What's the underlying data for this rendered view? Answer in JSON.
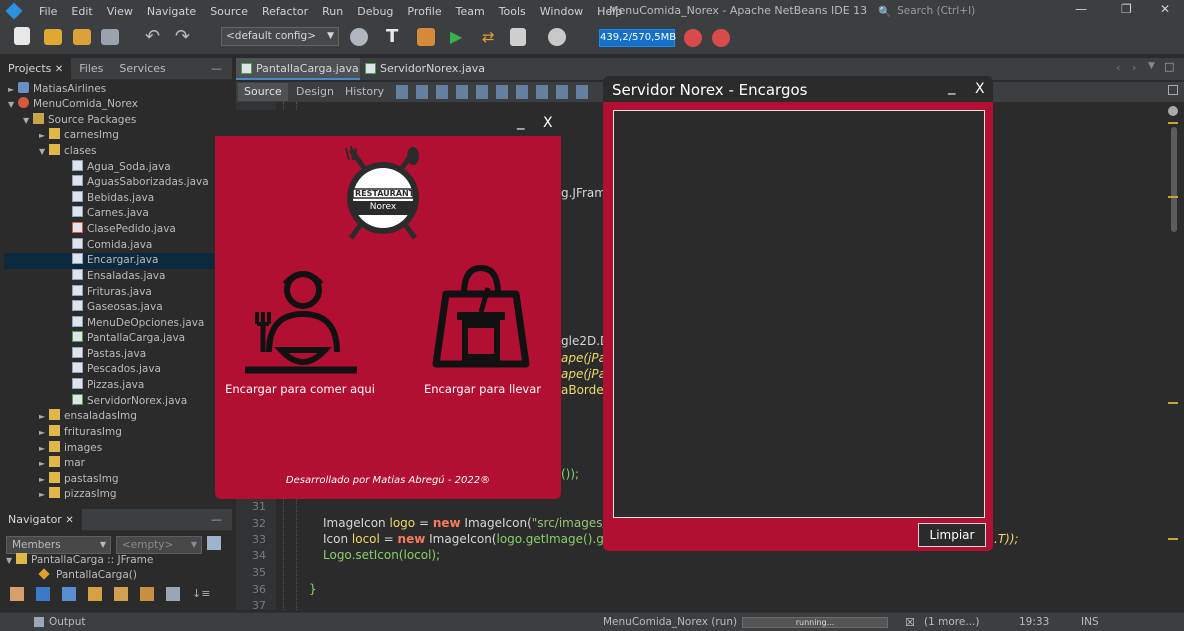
{
  "menu": [
    "File",
    "Edit",
    "View",
    "Navigate",
    "Source",
    "Refactor",
    "Run",
    "Debug",
    "Profile",
    "Team",
    "Tools",
    "Window",
    "Help"
  ],
  "app_title": "MenuComida_Norex - Apache NetBeans IDE 13",
  "search_placeholder": "Search (Ctrl+I)",
  "toolbar": {
    "config": "<default config>",
    "memory": "439,2/570,5MB"
  },
  "left_tabs": [
    "Projects",
    "Files",
    "Services"
  ],
  "tree": [
    {
      "label": "MatiasAirlines",
      "icon": "project"
    },
    {
      "label": "MenuComida_Norex",
      "icon": "project2"
    },
    {
      "label": "Source Packages",
      "icon": "pkg"
    },
    {
      "label": "carnesImg",
      "icon": "folder"
    },
    {
      "label": "clases",
      "icon": "folder"
    },
    {
      "label": "Agua_Soda.java",
      "icon": "java"
    },
    {
      "label": "AguasSaborizadas.java",
      "icon": "java"
    },
    {
      "label": "Bebidas.java",
      "icon": "java"
    },
    {
      "label": "Carnes.java",
      "icon": "java"
    },
    {
      "label": "ClasePedido.java",
      "icon": "java"
    },
    {
      "label": "Comida.java",
      "icon": "java"
    },
    {
      "label": "Encargar.java",
      "icon": "java"
    },
    {
      "label": "Ensaladas.java",
      "icon": "java"
    },
    {
      "label": "Frituras.java",
      "icon": "java"
    },
    {
      "label": "Gaseosas.java",
      "icon": "java"
    },
    {
      "label": "MenuDeOpciones.java",
      "icon": "java"
    },
    {
      "label": "PantallaCarga.java",
      "icon": "java"
    },
    {
      "label": "Pastas.java",
      "icon": "java"
    },
    {
      "label": "Pescados.java",
      "icon": "java"
    },
    {
      "label": "Pizzas.java",
      "icon": "java"
    },
    {
      "label": "ServidorNorex.java",
      "icon": "java"
    },
    {
      "label": "ensaladasImg",
      "icon": "folder"
    },
    {
      "label": "friturasImg",
      "icon": "folder"
    },
    {
      "label": "images",
      "icon": "folder"
    },
    {
      "label": "mar",
      "icon": "folder"
    },
    {
      "label": "pastasImg",
      "icon": "folder"
    },
    {
      "label": "pizzasImg",
      "icon": "folder"
    }
  ],
  "navigator": {
    "tab": "Navigator",
    "members": "Members",
    "empty": "<empty>",
    "class_node": "PantallaCarga :: JFrame",
    "method_node": "PantallaCarga()"
  },
  "editor_tabs": [
    "PantallaCarga.java",
    "ServidorNorex.java"
  ],
  "editor_subtabs": [
    "Source",
    "Design",
    "History"
  ],
  "code_fragments": {
    "jframe": "g.JFram",
    "graphics": "gle2D.D",
    "ape1": "ape(jPar",
    "ape2": "ape(jPar",
    "borde": "aBorde)",
    "paren": "());",
    "line32_a": "ImageIcon ",
    "line32_var": "logo",
    "line32_b": " = ",
    "line32_new": "new",
    "line32_c": " ImageIcon(",
    "line32_str": "\"src/images/Logo",
    "line33_a": "Icon ",
    "line33_var": "locol",
    "line33_b": " = ",
    "line33_new": "new",
    "line33_c": " ImageIcon(",
    "line33_d": "logo.getImage().getSca",
    "line33_end": ".T));",
    "line34": "Logo.setIcon(locol);",
    "line36": "}"
  },
  "line_numbers": [
    "31",
    "32",
    "33",
    "34",
    "35",
    "36",
    "37"
  ],
  "win_carga": {
    "minimize": "_",
    "close": "X",
    "logo_top": "RESTAURANT",
    "logo_bottom": "Norex",
    "option1": "Encargar para comer aqui",
    "option2": "Encargar para llevar",
    "footer": "Desarrollado por Matias Abregú - 2022®"
  },
  "win_servidor": {
    "title": "Servidor Norex - Encargos",
    "minimize": "_",
    "close": "X",
    "button": "Limpiar"
  },
  "status": {
    "output": "Output",
    "running_app": "MenuComida_Norex (run)",
    "progress": "running...",
    "more": "(1 more...)",
    "time": "19:33",
    "mode": "INS"
  },
  "colors": {
    "accent_red": "#b20f32",
    "memory_blue": "#1470c8",
    "ide_bg": "#2b2b2b"
  }
}
